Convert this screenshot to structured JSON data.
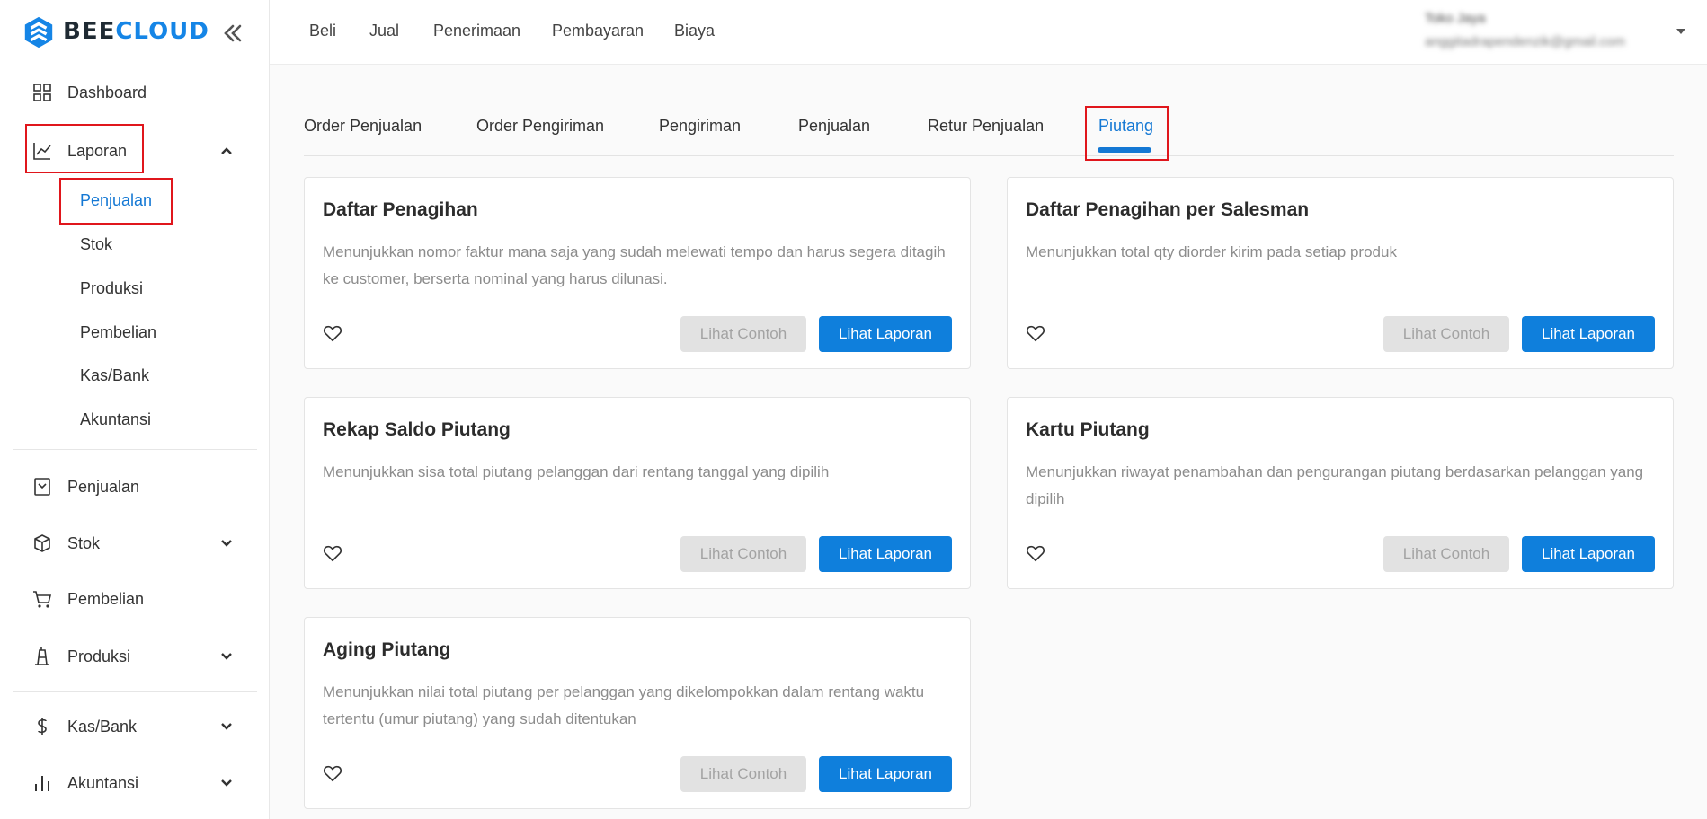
{
  "brand": {
    "name_part1": "BEE",
    "name_part2": "CLOUD",
    "color": "#1585e6"
  },
  "sidebar": {
    "items": [
      {
        "label": "Dashboard",
        "icon": "grid-icon"
      },
      {
        "label": "Laporan",
        "icon": "chart-line-icon",
        "expanded": true,
        "children": [
          "Penjualan",
          "Stok",
          "Produksi",
          "Pembelian",
          "Kas/Bank",
          "Akuntansi"
        ],
        "active_child": "Penjualan"
      },
      {
        "label": "Penjualan",
        "icon": "sales-box-icon"
      },
      {
        "label": "Stok",
        "icon": "cube-icon"
      },
      {
        "label": "Pembelian",
        "icon": "cart-icon"
      },
      {
        "label": "Produksi",
        "icon": "production-icon"
      },
      {
        "label": "Kas/Bank",
        "icon": "dollar-icon"
      },
      {
        "label": "Akuntansi",
        "icon": "bar-chart-icon"
      }
    ]
  },
  "topnav": {
    "links": [
      "Beli",
      "Jual",
      "Penerimaan",
      "Pembayaran",
      "Biaya"
    ]
  },
  "user": {
    "name": "Toko Jaya",
    "email": "anggitadrapendenzik@gmail.com"
  },
  "tabs": {
    "items": [
      "Order Penjualan",
      "Order Pengiriman",
      "Pengiriman",
      "Penjualan",
      "Retur Penjualan",
      "Piutang"
    ],
    "active": "Piutang"
  },
  "buttons": {
    "sample": "Lihat Contoh",
    "report": "Lihat Laporan"
  },
  "reports": [
    {
      "title": "Daftar Penagihan",
      "description": "Menunjukkan nomor faktur mana saja yang sudah melewati tempo dan harus segera ditagih ke customer, berserta nominal yang harus dilunasi."
    },
    {
      "title": "Daftar Penagihan per Salesman",
      "description": "Menunjukkan total qty diorder kirim pada setiap produk"
    },
    {
      "title": "Rekap Saldo Piutang",
      "description": "Menunjukkan sisa total piutang pelanggan dari rentang tanggal yang dipilih"
    },
    {
      "title": "Kartu Piutang",
      "description": "Menunjukkan riwayat penambahan dan pengurangan piutang berdasarkan pelanggan yang dipilih"
    },
    {
      "title": "Aging Piutang",
      "description": "Menunjukkan nilai total piutang per pelanggan yang dikelompokkan dalam rentang waktu tertentu (umur piutang) yang sudah ditentukan"
    }
  ],
  "colors": {
    "accent": "#1478d4",
    "button_primary": "#0f7fdc",
    "button_disabled": "#e2e2e2",
    "highlight": "#e0161c"
  }
}
